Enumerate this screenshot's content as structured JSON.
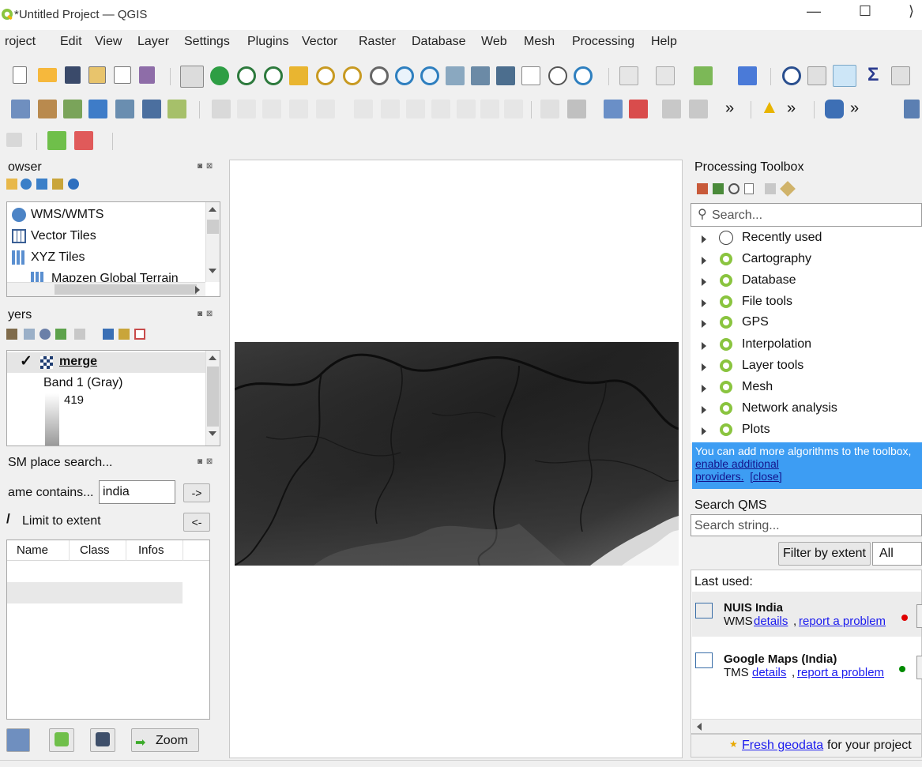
{
  "window": {
    "title": "*Untitled Project — QGIS",
    "minimize": "—",
    "maximize": "☐",
    "close": "⟩"
  },
  "menu": [
    "roject",
    "Edit",
    "View",
    "Layer",
    "Settings",
    "Plugins",
    "Vector",
    "Raster",
    "Database",
    "Web",
    "Mesh",
    "Processing",
    "Help"
  ],
  "toolbar": {
    "overflow1": "»",
    "overflow2": "»",
    "overflow3": "»"
  },
  "browser": {
    "title": "owser",
    "items": [
      "WMS/WMTS",
      "Vector Tiles",
      "XYZ Tiles",
      "Mapzen Global Terrain"
    ]
  },
  "layers": {
    "title": "yers",
    "layer_name": "merge",
    "band": "Band 1 (Gray)",
    "value": "419"
  },
  "osm": {
    "title": "SM place search...",
    "name_label": "ame contains...",
    "name_value": "india",
    "go_button": "->",
    "limit_label": "Limit to extent",
    "back_button": "<-",
    "columns": [
      "Name",
      "Class",
      "Infos"
    ],
    "zoom_button": "Zoom"
  },
  "processing": {
    "title": "Processing Toolbox",
    "search_placeholder": "Search...",
    "groups": [
      "Recently used",
      "Cartography",
      "Database",
      "File tools",
      "GPS",
      "Interpolation",
      "Layer tools",
      "Mesh",
      "Network analysis",
      "Plots"
    ],
    "notice_text": "You can add more algorithms to the toolbox,",
    "notice_link1": "enable additional",
    "notice_link2": "providers.",
    "notice_close": "[close]"
  },
  "qms": {
    "title": "Search QMS",
    "search_placeholder": "Search string...",
    "filter_button": "Filter by extent",
    "filter_select": "All",
    "last_used": "Last used:",
    "services": [
      {
        "name": "NUIS India",
        "type": "WMS",
        "details": "details",
        "report": "report a problem",
        "status_color": "#e00000"
      },
      {
        "name": "Google Maps (India)",
        "type": "TMS",
        "details": "details",
        "report": "report a problem",
        "status_color": "#008a00"
      }
    ],
    "fresh_link": "Fresh geodata",
    "fresh_text": "for your project"
  },
  "colors": {
    "accent_blue": "#3d9df3",
    "qgis_green": "#8ac43f"
  }
}
